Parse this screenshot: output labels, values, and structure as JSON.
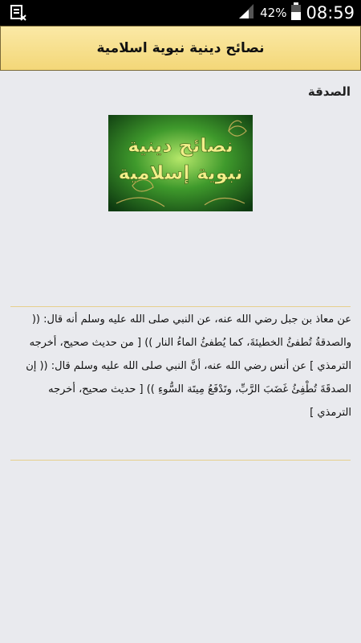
{
  "status_bar": {
    "battery_percent": "42%",
    "time": "08:59",
    "icons": [
      "calendar-x-icon",
      "signal-icon",
      "battery-icon"
    ]
  },
  "header": {
    "title": "نصائح دينية نبوية اسلامية"
  },
  "article": {
    "section_title": "الصدقة",
    "banner": {
      "line1": "نصائح دينية",
      "line2": "نبوية إسلامية"
    },
    "body": "عن معاذ بن جبل رضي الله عنه، عن النبي صلى الله عليه وسلم أنه قال: (( والصدقةُ تُطفئُ الخطيئةَ، كما يُطفئُ الماءُ النار )) [ من حديث صحيح، أخرجه الترمذي ] عن أنس رضي الله عنه، أنَّ النبي صلى الله عليه وسلم قال: (( إن الصدقَةَ تُطْفِئُ غَضَبَ الرَّبِّ، وتَدْفَعُ مِيتَة السُّوءِ )) [ حديث صحيح، أخرجه الترمذي ]"
  },
  "colors": {
    "header_top": "#fbe9a6",
    "header_bottom": "#f3d778",
    "divider": "#e6cf8c",
    "background": "#e9eaee"
  }
}
